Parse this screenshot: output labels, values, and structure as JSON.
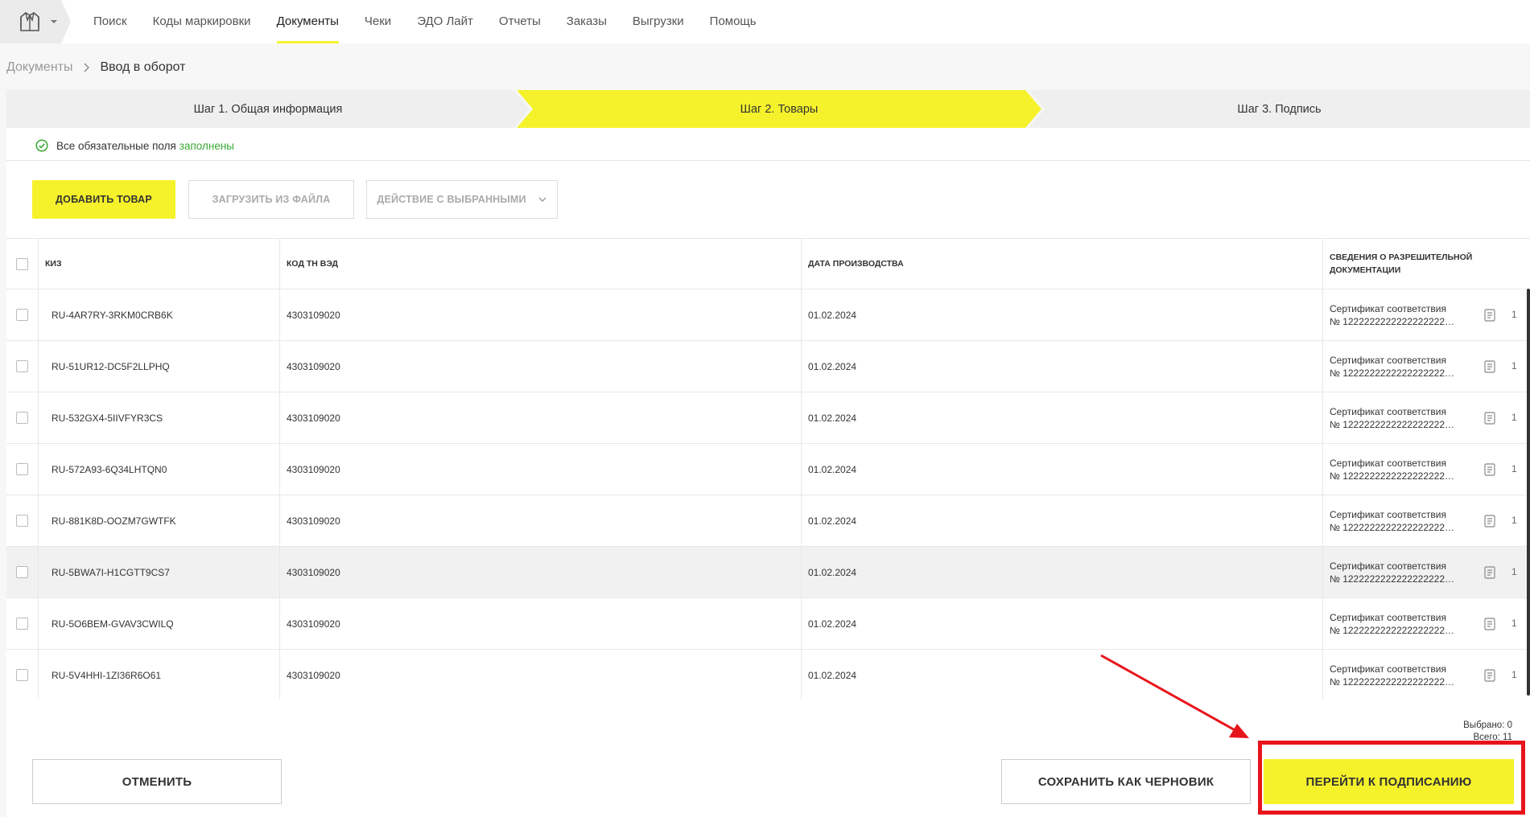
{
  "nav": {
    "items": [
      {
        "label": "Поиск"
      },
      {
        "label": "Коды маркировки"
      },
      {
        "label": "Документы",
        "active": true
      },
      {
        "label": "Чеки"
      },
      {
        "label": "ЭДО Лайт"
      },
      {
        "label": "Отчеты"
      },
      {
        "label": "Заказы"
      },
      {
        "label": "Выгрузки"
      },
      {
        "label": "Помощь"
      }
    ]
  },
  "breadcrumb": {
    "parent": "Документы",
    "current": "Ввод в оборот"
  },
  "steps": {
    "step1": "Шаг 1. Общая информация",
    "step2": "Шаг 2. Товары",
    "step3": "Шаг 3. Подпись"
  },
  "status": {
    "text": "Все обязательные поля",
    "ok": "заполнены"
  },
  "toolbar": {
    "add": "ДОБАВИТЬ ТОВАР",
    "load": "ЗАГРУЗИТЬ ИЗ ФАЙЛА",
    "action": "ДЕЙСТВИЕ С ВЫБРАННЫМИ"
  },
  "table": {
    "headers": {
      "kiz": "КИЗ",
      "tnved": "КОД ТН ВЭД",
      "date": "ДАТА ПРОИЗВОДСТВА",
      "doc": "СВЕДЕНИЯ О РАЗРЕШИТЕЛЬНОЙ ДОКУМЕНТАЦИИ"
    },
    "rows": [
      {
        "kiz": "RU-4AR7RY-3RKM0CRB6K",
        "tnved": "4303109020",
        "date": "01.02.2024",
        "doc1": "Сертификат соответствия",
        "doc2": "№ 1222222222222222222222",
        "count": "1"
      },
      {
        "kiz": "RU-51UR12-DC5F2LLPHQ",
        "tnved": "4303109020",
        "date": "01.02.2024",
        "doc1": "Сертификат соответствия",
        "doc2": "№ 1222222222222222222222",
        "count": "1"
      },
      {
        "kiz": "RU-532GX4-5IIVFYR3CS",
        "tnved": "4303109020",
        "date": "01.02.2024",
        "doc1": "Сертификат соответствия",
        "doc2": "№ 1222222222222222222222",
        "count": "1"
      },
      {
        "kiz": "RU-572A93-6Q34LHTQN0",
        "tnved": "4303109020",
        "date": "01.02.2024",
        "doc1": "Сертификат соответствия",
        "doc2": "№ 1222222222222222222222",
        "count": "1"
      },
      {
        "kiz": "RU-881K8D-OOZM7GWTFK",
        "tnved": "4303109020",
        "date": "01.02.2024",
        "doc1": "Сертификат соответствия",
        "doc2": "№ 1222222222222222222222",
        "count": "1"
      },
      {
        "kiz": "RU-5BWA7I-H1CGTT9CS7",
        "tnved": "4303109020",
        "date": "01.02.2024",
        "doc1": "Сертификат соответствия",
        "doc2": "№ 1222222222222222222222",
        "count": "1"
      },
      {
        "kiz": "RU-5O6BEM-GVAV3CWILQ",
        "tnved": "4303109020",
        "date": "01.02.2024",
        "doc1": "Сертификат соответствия",
        "doc2": "№ 1222222222222222222222",
        "count": "1"
      },
      {
        "kiz": "RU-5V4HHI-1ZI36R6O61",
        "tnved": "4303109020",
        "date": "01.02.2024",
        "doc1": "Сертификат соответствия",
        "doc2": "№ 1222222222222222222222",
        "count": "1"
      }
    ]
  },
  "footer": {
    "selected": "Выбрано: 0",
    "total": "Всего: 11",
    "cancel": "ОТМЕНИТЬ",
    "draft": "СОХРАНИТЬ КАК ЧЕРНОВИК",
    "sign": "ПЕРЕЙТИ К ПОДПИСАНИЮ"
  },
  "colors": {
    "accent": "#f5f22b",
    "success": "#3aa935",
    "annotation": "#e8141c"
  }
}
